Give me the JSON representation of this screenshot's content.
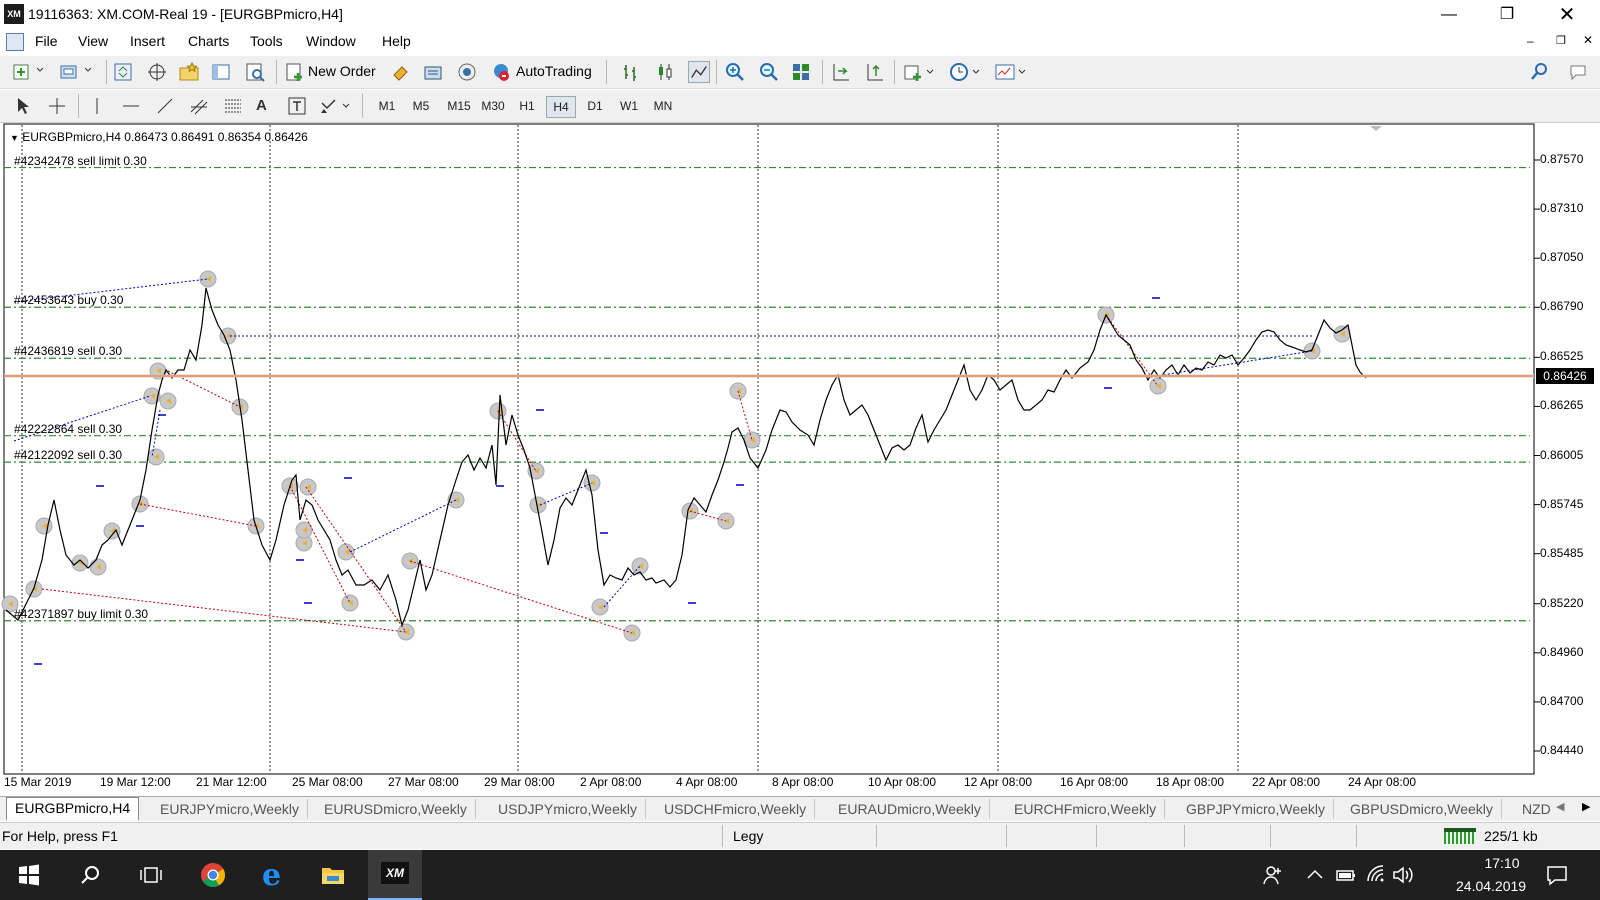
{
  "window": {
    "title": "19116363: XM.COM-Real 19 - [EURGBPmicro,H4]",
    "app_icon_text": "XM"
  },
  "menu": [
    "File",
    "View",
    "Insert",
    "Charts",
    "Tools",
    "Window",
    "Help"
  ],
  "toolbar": {
    "new_order": "New Order",
    "autotrading": "AutoTrading"
  },
  "timeframes": [
    "M1",
    "M5",
    "M15",
    "M30",
    "H1",
    "H4",
    "D1",
    "W1",
    "MN"
  ],
  "active_timeframe": "H4",
  "chart": {
    "symbol_line": "EURGBPmicro,H4  0.86473 0.86491 0.86354 0.86426",
    "current_price": "0.86426",
    "price_ticks": [
      "0.87570",
      "0.87310",
      "0.87050",
      "0.86790",
      "0.86525",
      "0.86265",
      "0.86005",
      "0.85745",
      "0.85485",
      "0.85220",
      "0.84960",
      "0.84700",
      "0.84440"
    ],
    "time_ticks": [
      "15 Mar 2019",
      "19 Mar 12:00",
      "21 Mar 12:00",
      "25 Mar 08:00",
      "27 Mar 08:00",
      "29 Mar 08:00",
      "2 Apr 08:00",
      "4 Apr 08:00",
      "8 Apr 08:00",
      "10 Apr 08:00",
      "12 Apr 08:00",
      "16 Apr 08:00",
      "18 Apr 08:00",
      "22 Apr 08:00",
      "24 Apr 08:00"
    ],
    "orders": [
      {
        "label": "#42342478 sell limit 0.30",
        "price": 0.8753
      },
      {
        "label": "#42453643 buy 0.30",
        "price": 0.8679
      },
      {
        "label": "#42436819 sell 0.30",
        "price": 0.8652
      },
      {
        "label": "#42222864 sell 0.30",
        "price": 0.8611
      },
      {
        "label": "#42122092 sell 0.30",
        "price": 0.8597
      },
      {
        "label": "#42371897 buy limit 0.30",
        "price": 0.8513
      }
    ],
    "colors": {
      "line": "#000000",
      "order_line": "#2e8b2e",
      "grid": "#000000",
      "sell_trade": "#c00000",
      "buy_trade": "#0000c0",
      "price_tag_bg": "#000000"
    }
  },
  "tabs": [
    "EURGBPmicro,H4",
    "EURJPYmicro,Weekly",
    "EURUSDmicro,Weekly",
    "USDJPYmicro,Weekly",
    "USDCHFmicro,Weekly",
    "EURAUDmicro,Weekly",
    "EURCHFmicro,Weekly",
    "GBPJPYmicro,Weekly",
    "GBPUSDmicro,Weekly",
    "NZD"
  ],
  "status": {
    "help": "For Help, press F1",
    "profile": "Legy",
    "traffic": "225/1 kb"
  },
  "taskbar": {
    "time": "17:10",
    "date": "24.04.2019"
  }
}
